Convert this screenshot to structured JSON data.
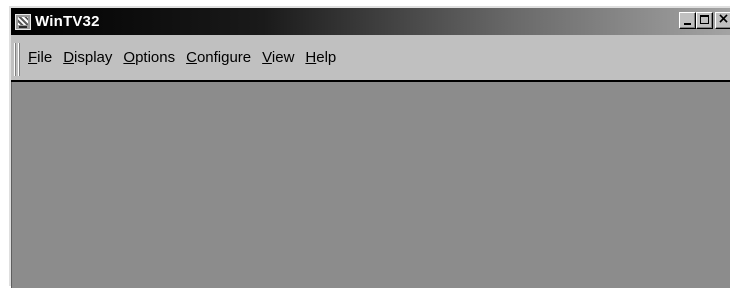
{
  "window": {
    "title": "WinTV32",
    "app_icon": "tv-app-icon"
  },
  "caption_buttons": {
    "minimize": "minimize-icon",
    "maximize": "maximize-icon",
    "close": "close-icon",
    "close_glyph": "×"
  },
  "menu": {
    "items": [
      {
        "accel": "F",
        "rest": "ile"
      },
      {
        "accel": "D",
        "rest": "isplay"
      },
      {
        "accel": "O",
        "rest": "ptions"
      },
      {
        "accel": "C",
        "rest": "onfigure"
      },
      {
        "accel": "V",
        "rest": "iew"
      },
      {
        "accel": "H",
        "rest": "elp"
      }
    ]
  },
  "colors": {
    "titlebar_start": "#000000",
    "titlebar_end": "#a4a4a4",
    "face": "#c0c0c0",
    "client": "#8c8c8c"
  }
}
